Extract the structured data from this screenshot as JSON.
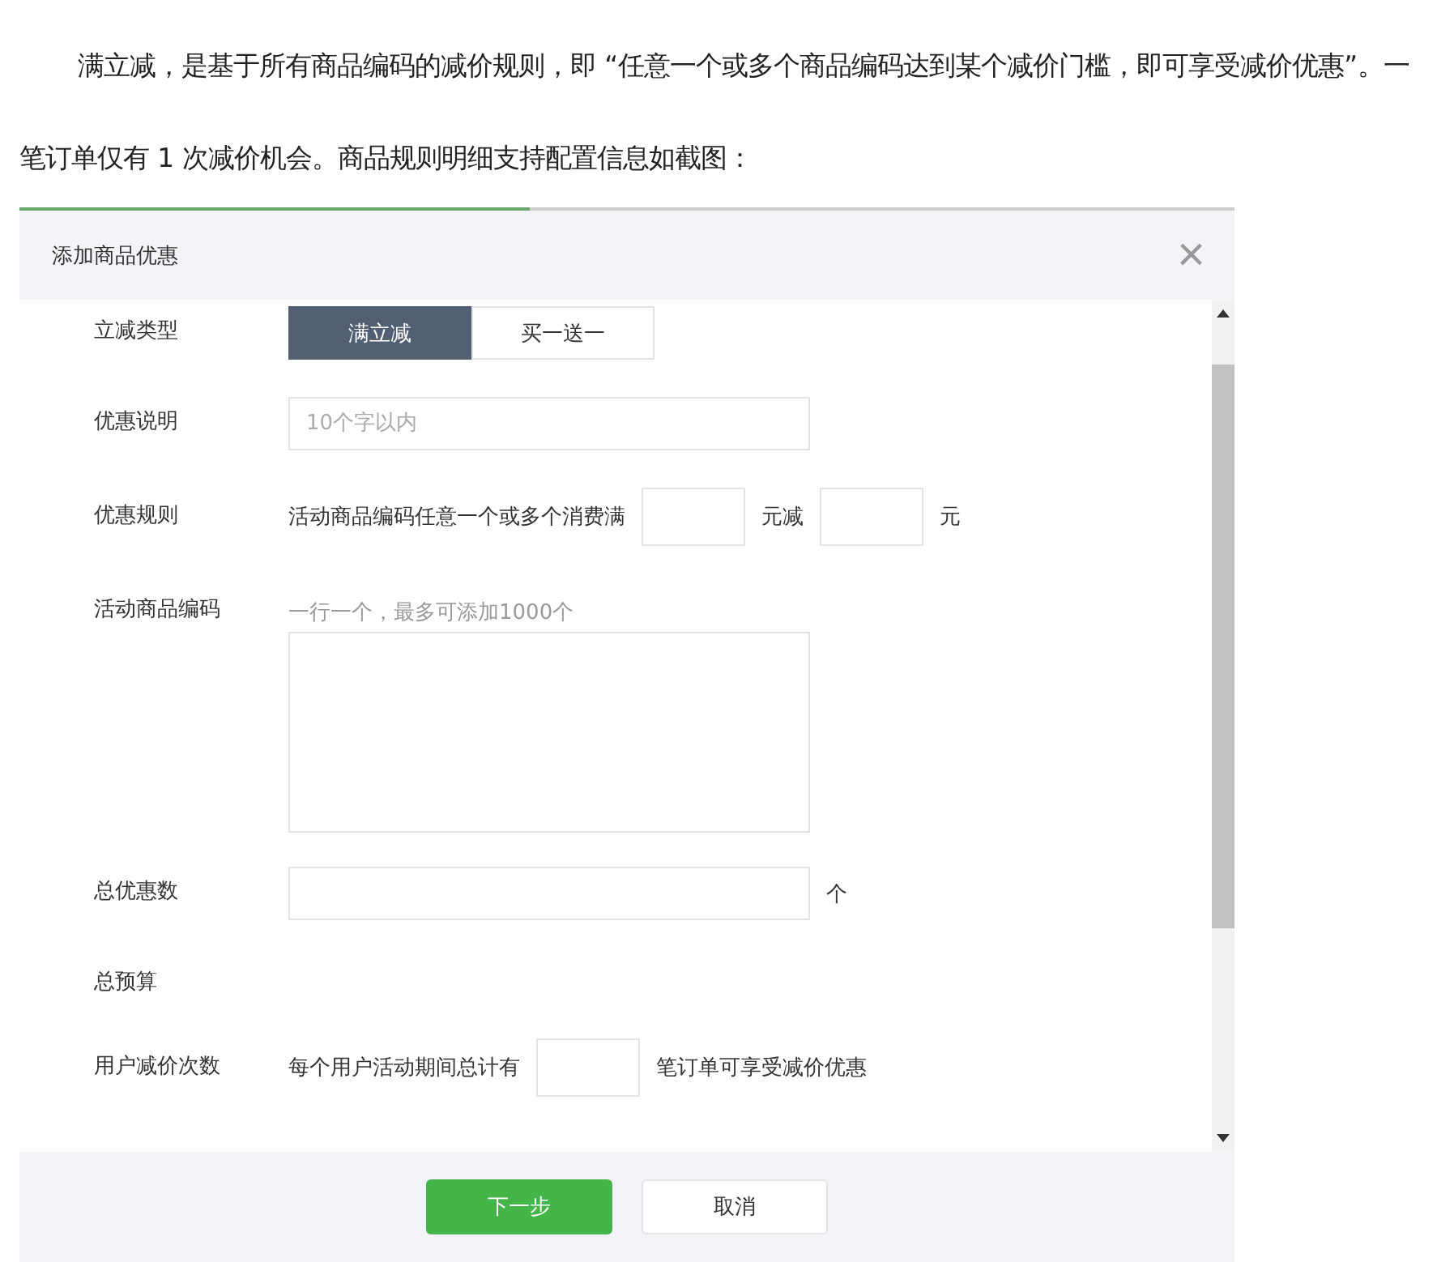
{
  "intro": {
    "paragraph_1": "满立减，是基于所有商品编码的减价规则，即 “任意一个或多个商品编码达到某个减价门槛，即可享受减价优惠”。一笔订单仅有 1 次减价机会。商品规则明细支持配置信息如截图："
  },
  "dialog": {
    "progress": {
      "level": 0.42
    },
    "title": "添加商品优惠",
    "close": "×",
    "fields": [
      {
        "kind": "segmented",
        "label": "立减类型",
        "options": [
          {
            "label": "满立减",
            "selected": true
          },
          {
            "label": "买一送一",
            "selected": false
          }
        ]
      },
      {
        "kind": "input",
        "label": "优惠说明",
        "placeholder": "10个字以内"
      },
      {
        "kind": "rule",
        "label": "优惠规则",
        "parts": [
          "活动商品编码任意一个或多个消费满",
          "元减",
          "元"
        ]
      },
      {
        "kind": "textarea",
        "label": "活动商品编码",
        "hint": "一行一个，最多可添加1000个"
      },
      {
        "kind": "input",
        "label": "总优惠数",
        "suffix": "个"
      },
      {
        "kind": "plain",
        "label": "总预算"
      },
      {
        "kind": "rule",
        "label": "用户减价次数",
        "parts": [
          "每个用户活动期间总计有",
          "笔订单可享受减价优惠"
        ]
      }
    ],
    "buttons": [
      {
        "label": "下一步",
        "primary": true
      },
      {
        "label": "取消",
        "primary": false
      }
    ]
  }
}
